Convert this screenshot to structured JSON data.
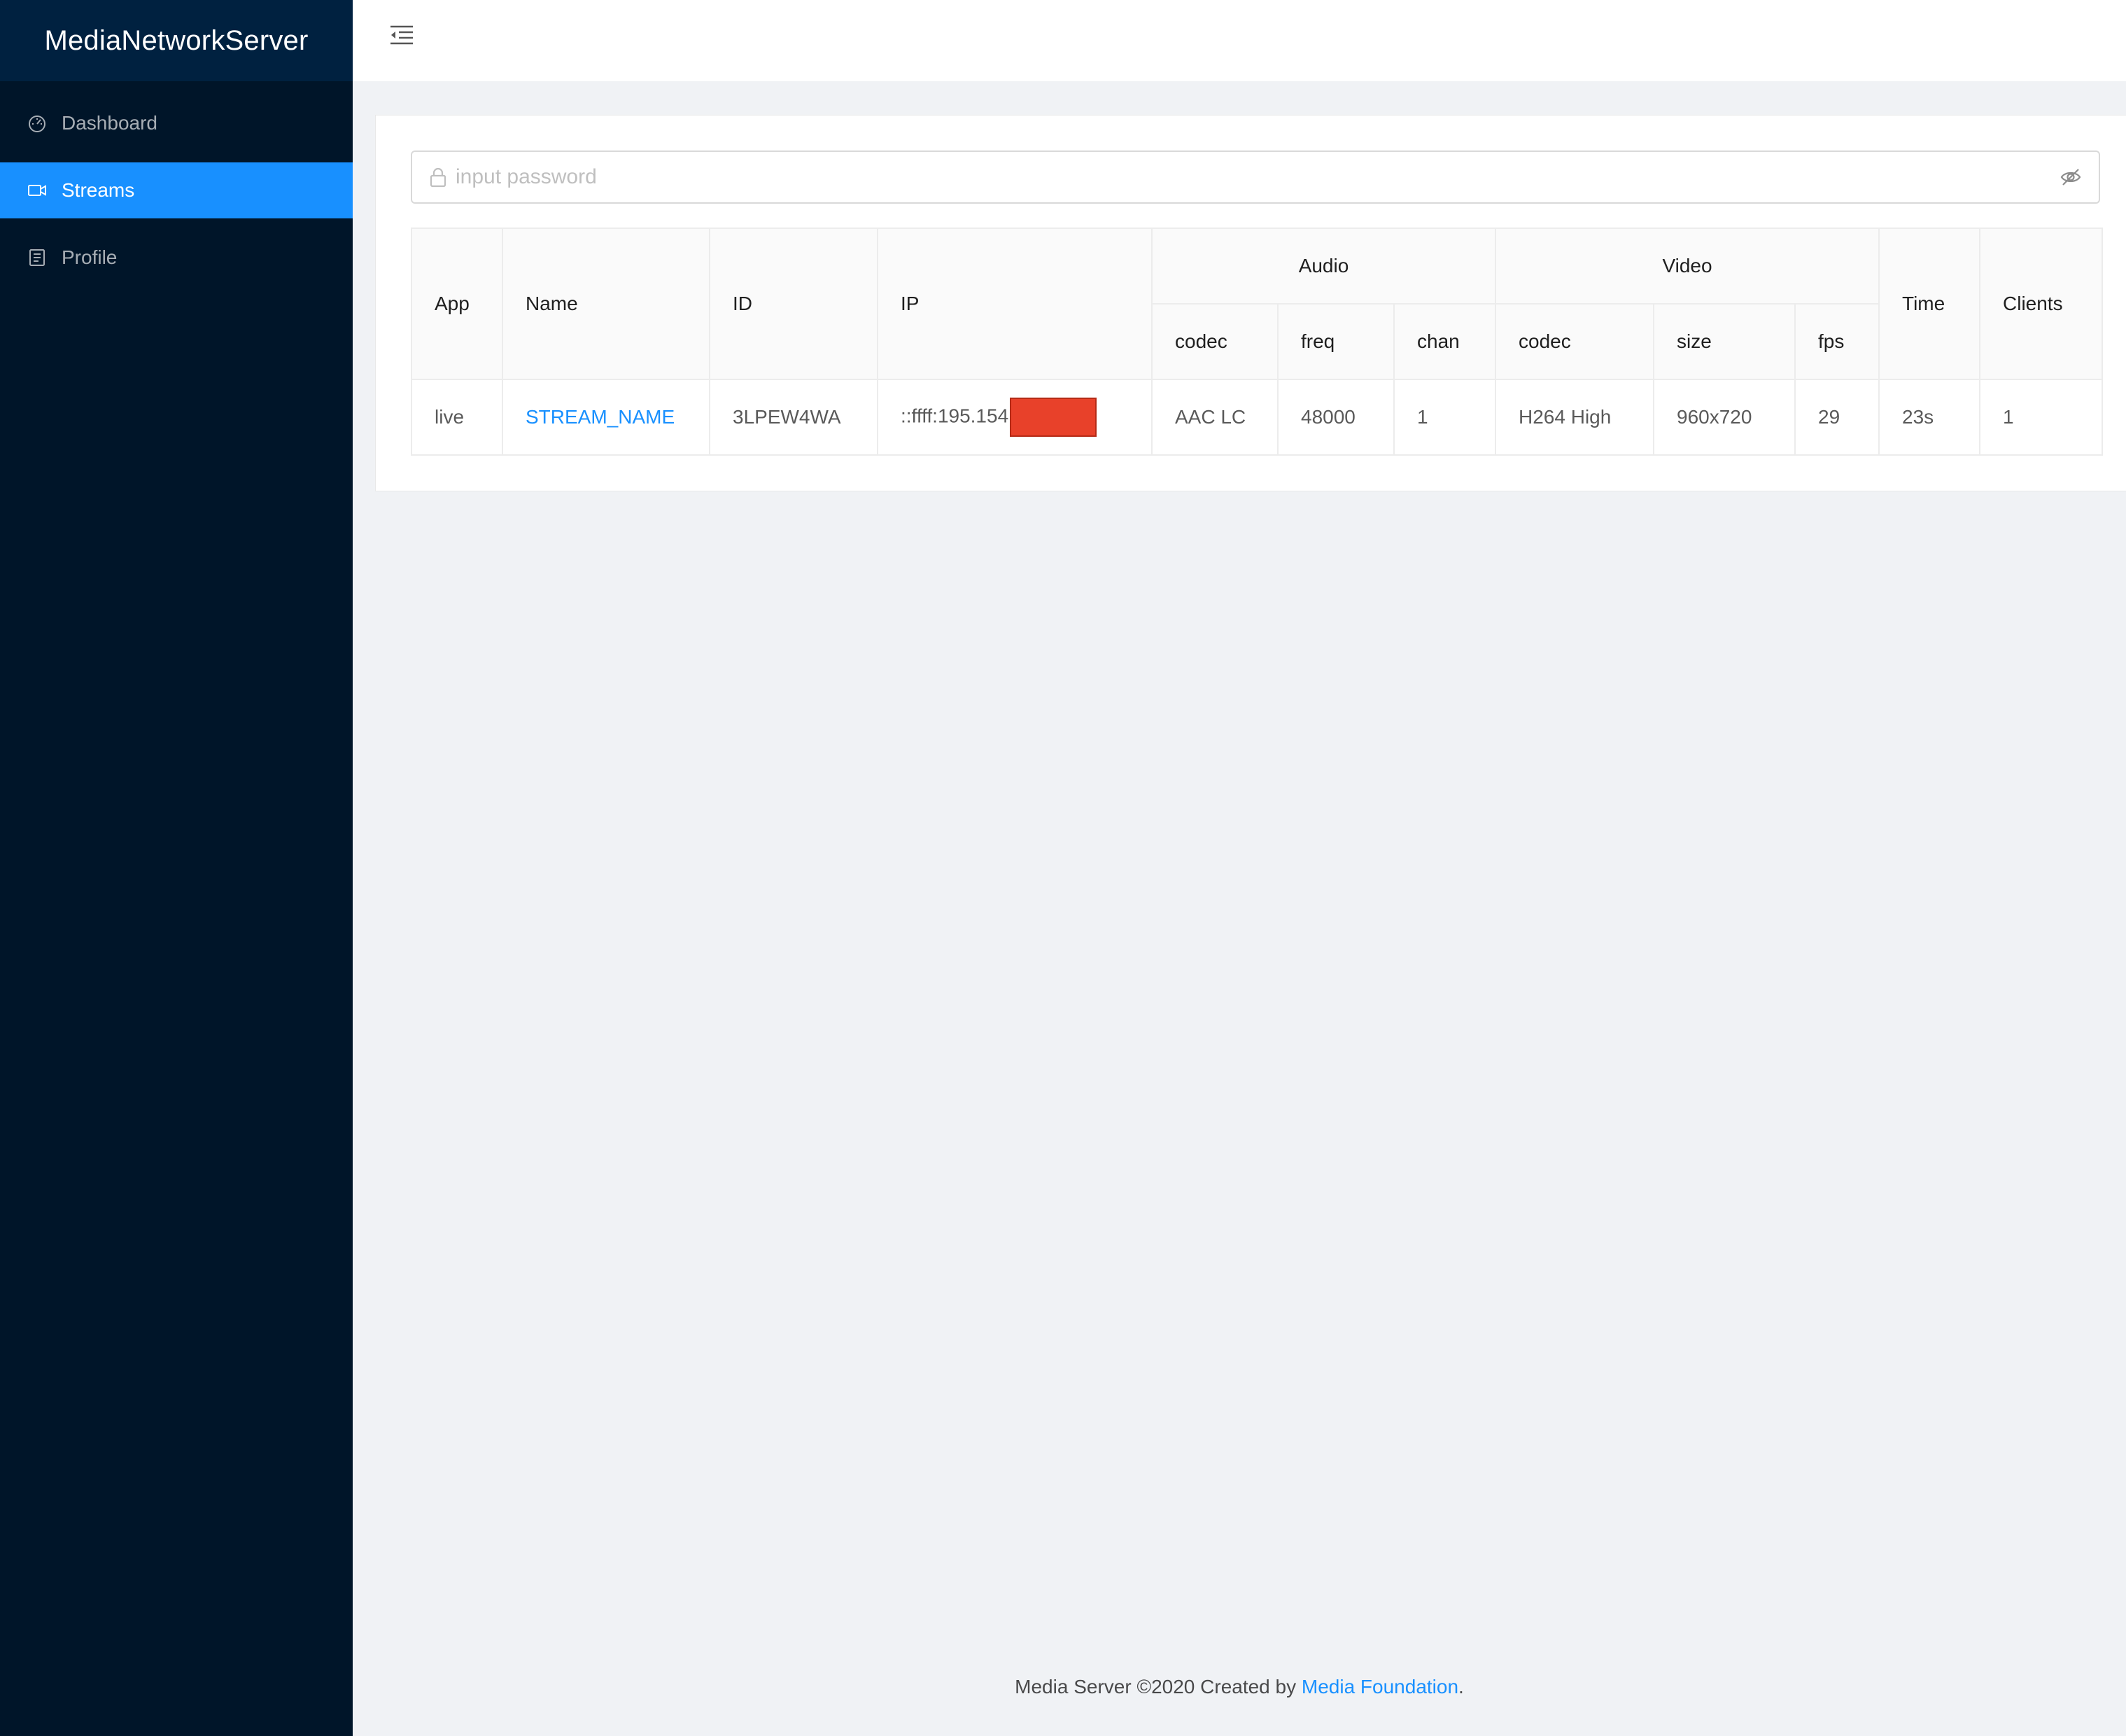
{
  "app": {
    "brand": "MediaNetworkServer"
  },
  "sidebar": {
    "items": [
      {
        "label": "Dashboard",
        "icon": "dashboard-icon",
        "active": false
      },
      {
        "label": "Streams",
        "icon": "video-camera-icon",
        "active": true
      },
      {
        "label": "Profile",
        "icon": "profile-icon",
        "active": false
      }
    ]
  },
  "header": {
    "menu_fold_icon": "menu-fold-icon"
  },
  "password": {
    "placeholder": "input password",
    "value": "",
    "lock_icon": "lock-icon",
    "toggle_icon": "eye-invisible-icon"
  },
  "table": {
    "headers": {
      "app": "App",
      "name": "Name",
      "id": "ID",
      "ip": "IP",
      "audio": "Audio",
      "video": "Video",
      "time": "Time",
      "clients": "Clients",
      "audio_codec": "codec",
      "audio_freq": "freq",
      "audio_chan": "chan",
      "video_codec": "codec",
      "video_size": "size",
      "video_fps": "fps"
    },
    "rows": [
      {
        "app": "live",
        "name": "STREAM_NAME",
        "id": "3LPEW4WA",
        "ip": "::ffff:195.154",
        "audio_codec": "AAC LC",
        "audio_freq": "48000",
        "audio_chan": "1",
        "video_codec": "H264 High",
        "video_size": "960x720",
        "video_fps": "29",
        "time": "23s",
        "clients": "1"
      }
    ]
  },
  "footer": {
    "text": "Media Server ©2020 Created by ",
    "link": "Media Foundation",
    "end": "."
  },
  "colors": {
    "sidebar_bg": "#001529",
    "brand_bg": "#002140",
    "accent": "#1890ff",
    "redaction": "#e8412a"
  }
}
